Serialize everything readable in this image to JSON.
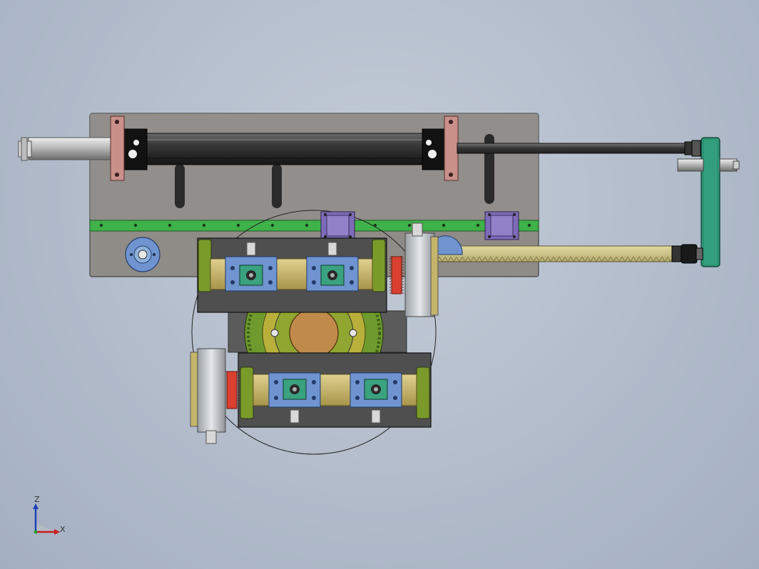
{
  "viewport": {
    "view": "top-view",
    "model": "cylinder-rack-pinion-rotary-fixture"
  },
  "triad": {
    "axis_z": "Z",
    "axis_x": "X",
    "colors": {
      "z": "#1f3fb8",
      "x": "#c81e1e",
      "y": "#2a9a2a"
    }
  },
  "colors": {
    "background": "#b8c1cf",
    "base_plate": "#8f8b87",
    "green_strip": "#3fb24a",
    "clamp_pink": "#c9908a",
    "purple_block": "#7e6bb8",
    "rack_yellow": "#cfc68a",
    "teal_bracket": "#2c9474",
    "yellow_body": "#c8b561",
    "blue_block": "#6f94cf",
    "green_gear": "#6f9a2e",
    "bronze_hub": "#c08a4a",
    "red_gear": "#d94030"
  }
}
